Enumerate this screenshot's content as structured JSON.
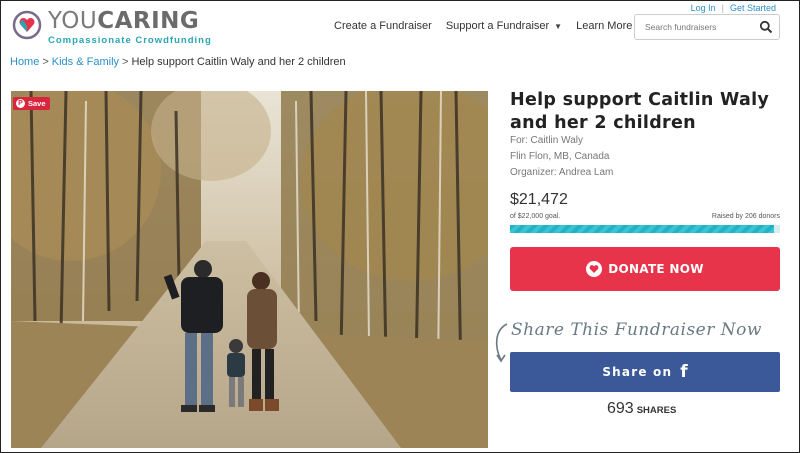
{
  "brand": {
    "name_light": "YOU",
    "name_bold": "CARING",
    "tagline": "Compassionate Crowdfunding",
    "accent_color": "#2aa5b3",
    "donate_color": "#e8344a",
    "facebook_color": "#3b5998"
  },
  "top_links": {
    "login": "Log In",
    "separator": "|",
    "signup": "Get Started"
  },
  "nav": {
    "items": [
      {
        "label": "Create a Fundraiser",
        "dropdown": false
      },
      {
        "label": "Support a Fundraiser",
        "dropdown": true
      },
      {
        "label": "Learn More",
        "dropdown": true
      }
    ]
  },
  "search": {
    "placeholder": "Search fundraisers",
    "icon": "magnifier-icon"
  },
  "breadcrumb": {
    "home": "Home",
    "separator": ">",
    "category": "Kids & Family",
    "current": "Help support Caitlin Waly and her 2 children"
  },
  "photo": {
    "save_label": "Save",
    "save_icon": "pinterest-icon"
  },
  "campaign": {
    "title": "Help support Caitlin Waly and her 2 children",
    "beneficiary": "For: Caitlin Waly",
    "location": "Flin Flon, MB, Canada",
    "organizer": "Organizer: Andrea Lam",
    "raised": "$21,472",
    "goal": "of $22,000 goal.",
    "donors": "Raised by 206 donors",
    "progress_fraction": 0.976
  },
  "donate": {
    "label": "DONATE NOW",
    "icon": "heart-hand-icon"
  },
  "share": {
    "heading": "Share This Fundraiser Now",
    "facebook_label": "Share on",
    "facebook_glyph": "f",
    "count": "693",
    "count_label": "SHARES"
  }
}
